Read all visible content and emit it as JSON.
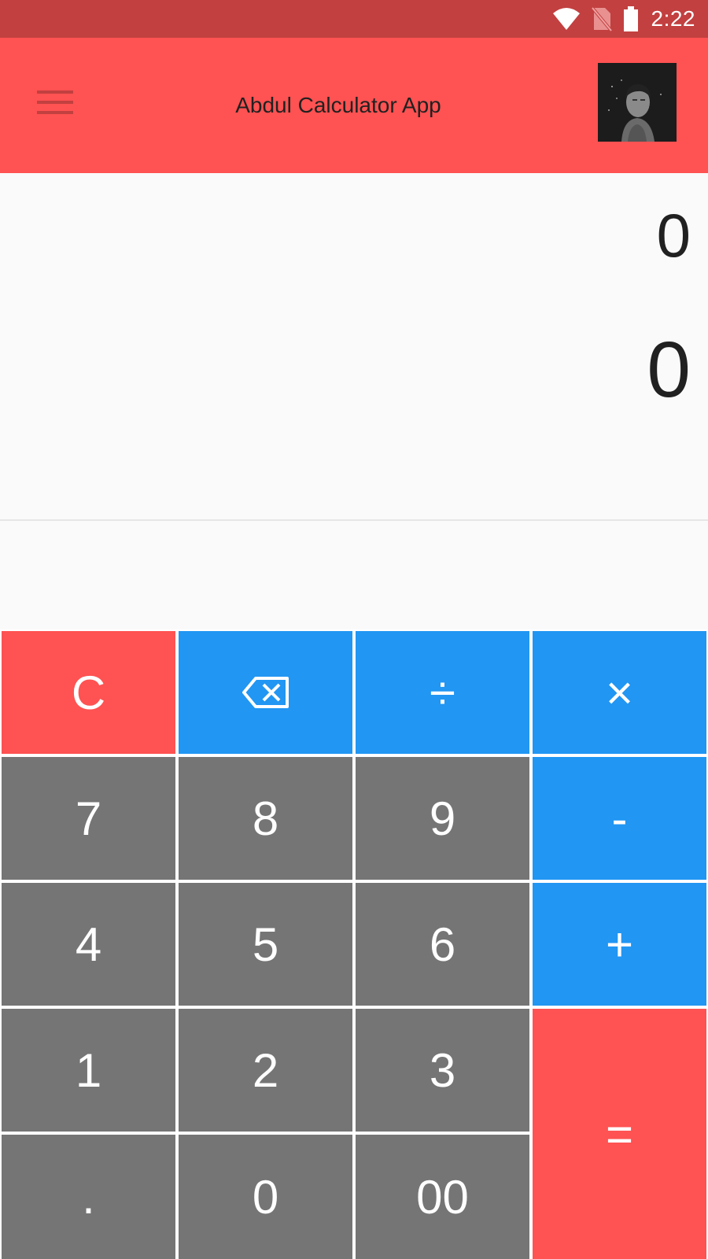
{
  "status_bar": {
    "time": "2:22",
    "icons": [
      "wifi-icon",
      "no-sim-icon",
      "battery-icon"
    ]
  },
  "app_bar": {
    "title": "Abdul Calculator App",
    "menu_icon": "hamburger-menu-icon",
    "avatar": "profile-avatar"
  },
  "display": {
    "expression": "0",
    "result": "0"
  },
  "keypad": {
    "clear": "C",
    "backspace_icon": "backspace-icon",
    "divide": "÷",
    "multiply": "×",
    "seven": "7",
    "eight": "8",
    "nine": "9",
    "minus": "-",
    "four": "4",
    "five": "5",
    "six": "6",
    "plus": "+",
    "one": "1",
    "two": "2",
    "three": "3",
    "equals": "=",
    "decimal": ".",
    "zero": "0",
    "double_zero": "00"
  },
  "colors": {
    "status_bar": "#c24040",
    "app_bar": "#ff5252",
    "accent_red": "#ff5252",
    "operator_blue": "#2196f3",
    "digit_grey": "#757575",
    "background": "#fafafa"
  }
}
